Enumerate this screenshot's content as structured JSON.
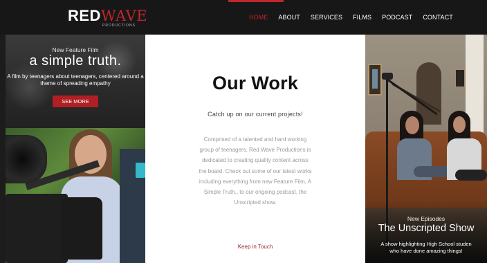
{
  "brand": {
    "name_part1": "RED",
    "name_part2": "WAVE",
    "tagline": "PRODUCTIONS"
  },
  "nav": {
    "items": [
      {
        "label": "HOME",
        "active": true
      },
      {
        "label": "ABOUT",
        "active": false
      },
      {
        "label": "SERVICES",
        "active": false
      },
      {
        "label": "FILMS",
        "active": false
      },
      {
        "label": "PODCAST",
        "active": false
      },
      {
        "label": "CONTACT",
        "active": false
      }
    ]
  },
  "feature": {
    "eyebrow": "New Feature Film",
    "title": "a simple truth.",
    "description": "A film by teenagers about teenagers, centered around a theme of spreading empathy",
    "button_label": "SEE MORE"
  },
  "main": {
    "title": "Our Work",
    "subtitle": "Catch up on our current projects!",
    "body": "Comprised of a talented and hard working group of teenagers, Red Wave Productions is dedicated to creating quality content across the board. Check out some of our latest works including everything from new Feature Film, A Simple Truth., to our ongoing podcast, the Unscripted show.",
    "link_label": "Keep in Touch"
  },
  "podcast": {
    "eyebrow": "New Episodes",
    "title": "The Unscripted Show",
    "description_line1": "A show highlighting High School studen",
    "description_line2": "who have done amazing things!"
  },
  "colors": {
    "accent": "#c0262c",
    "header_bg": "#171717",
    "button_bg": "#b01f24"
  }
}
